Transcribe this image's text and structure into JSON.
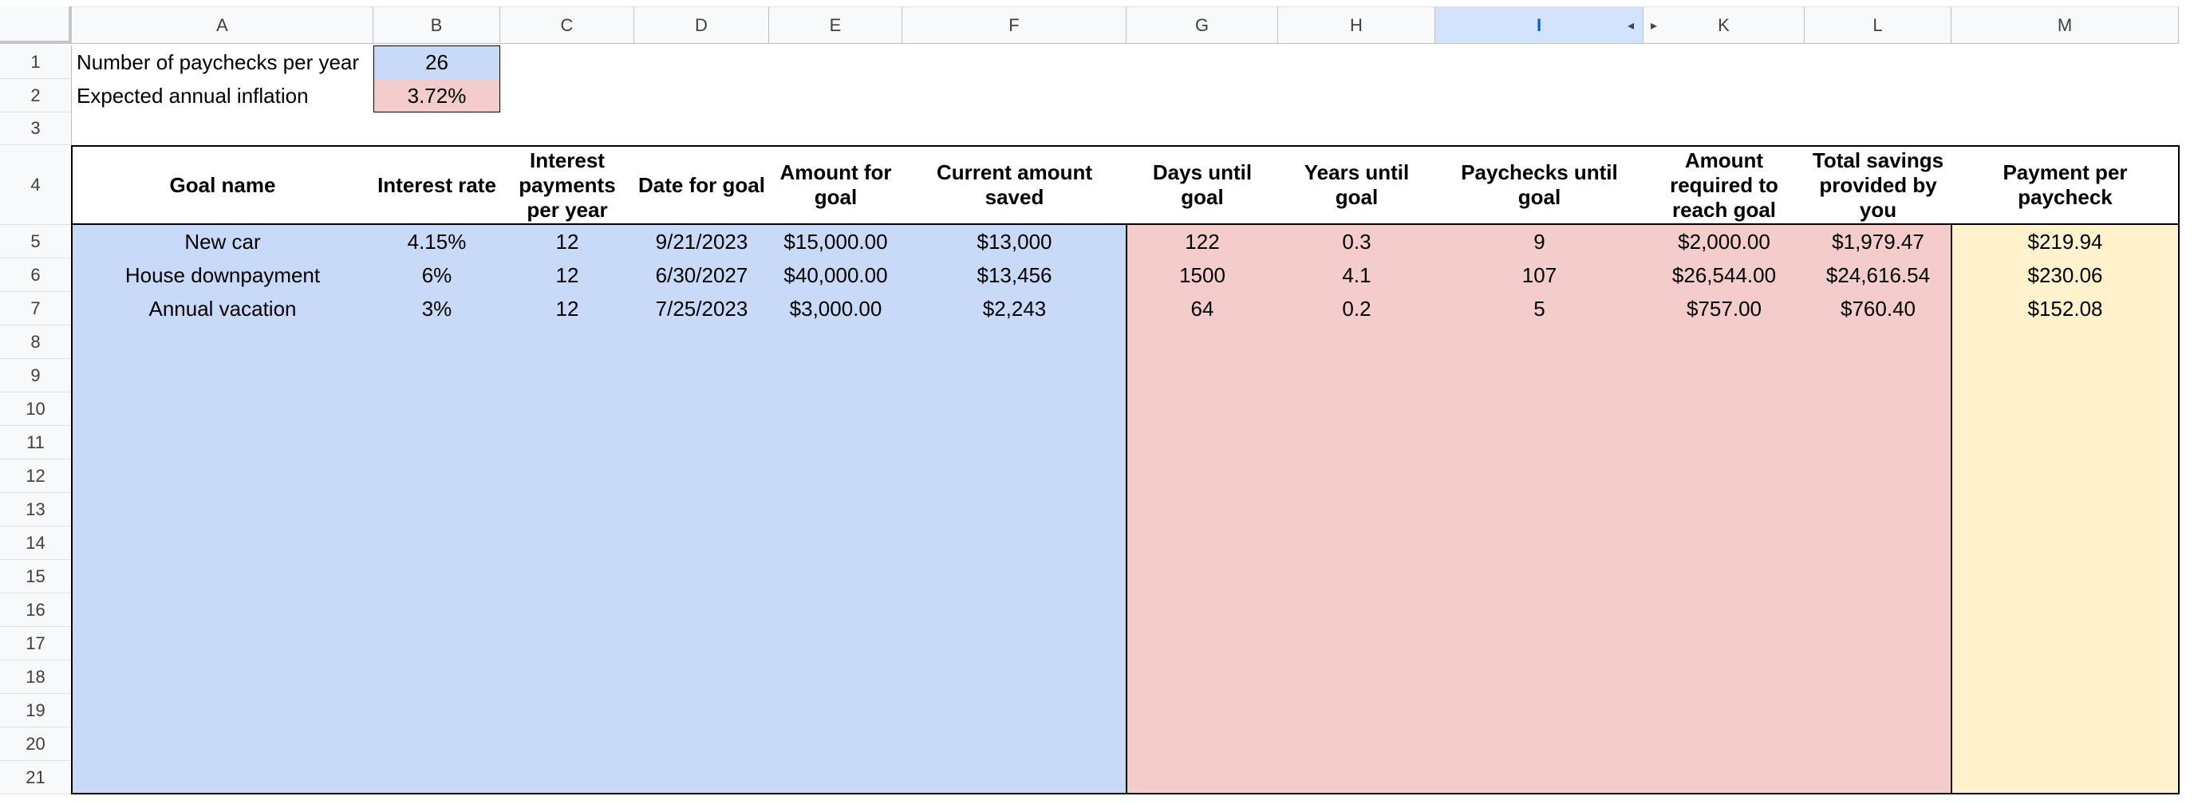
{
  "column_headers": [
    "A",
    "B",
    "C",
    "D",
    "E",
    "F",
    "G",
    "H",
    "I",
    "K",
    "L",
    "M"
  ],
  "selected_column": "I",
  "row_numbers": [
    "1",
    "2",
    "3",
    "4",
    "5",
    "6",
    "7",
    "8",
    "9",
    "10",
    "11",
    "12",
    "13",
    "14",
    "15",
    "16",
    "17",
    "18",
    "19",
    "20",
    "21"
  ],
  "colors": {
    "input_blue": "#c9daf8",
    "calc_red": "#f4cccc",
    "result_yellow": "#fff2cc",
    "selected_header": "#d3e3fd"
  },
  "settings": {
    "paychecks_label": "Number of paychecks per year",
    "paychecks_value": "26",
    "inflation_label": "Expected annual inflation",
    "inflation_value": "3.72%"
  },
  "table": {
    "headers": [
      "Goal name",
      "Interest rate",
      "Interest payments per year",
      "Date for goal",
      "Amount for goal",
      "Current amount saved",
      "Days until goal",
      "Years until goal",
      "Paychecks until goal",
      "Amount required to reach goal",
      "Total savings provided by you",
      "Payment per paycheck"
    ],
    "rows": [
      [
        "New car",
        "4.15%",
        "12",
        "9/21/2023",
        "$15,000.00",
        "$13,000",
        "122",
        "0.3",
        "9",
        "$2,000.00",
        "$1,979.47",
        "$219.94"
      ],
      [
        "House downpayment",
        "6%",
        "12",
        "6/30/2027",
        "$40,000.00",
        "$13,456",
        "1500",
        "4.1",
        "107",
        "$26,544.00",
        "$24,616.54",
        "$230.06"
      ],
      [
        "Annual vacation",
        "3%",
        "12",
        "7/25/2023",
        "$3,000.00",
        "$2,243",
        "64",
        "0.2",
        "5",
        "$757.00",
        "$760.40",
        "$152.08"
      ]
    ]
  }
}
